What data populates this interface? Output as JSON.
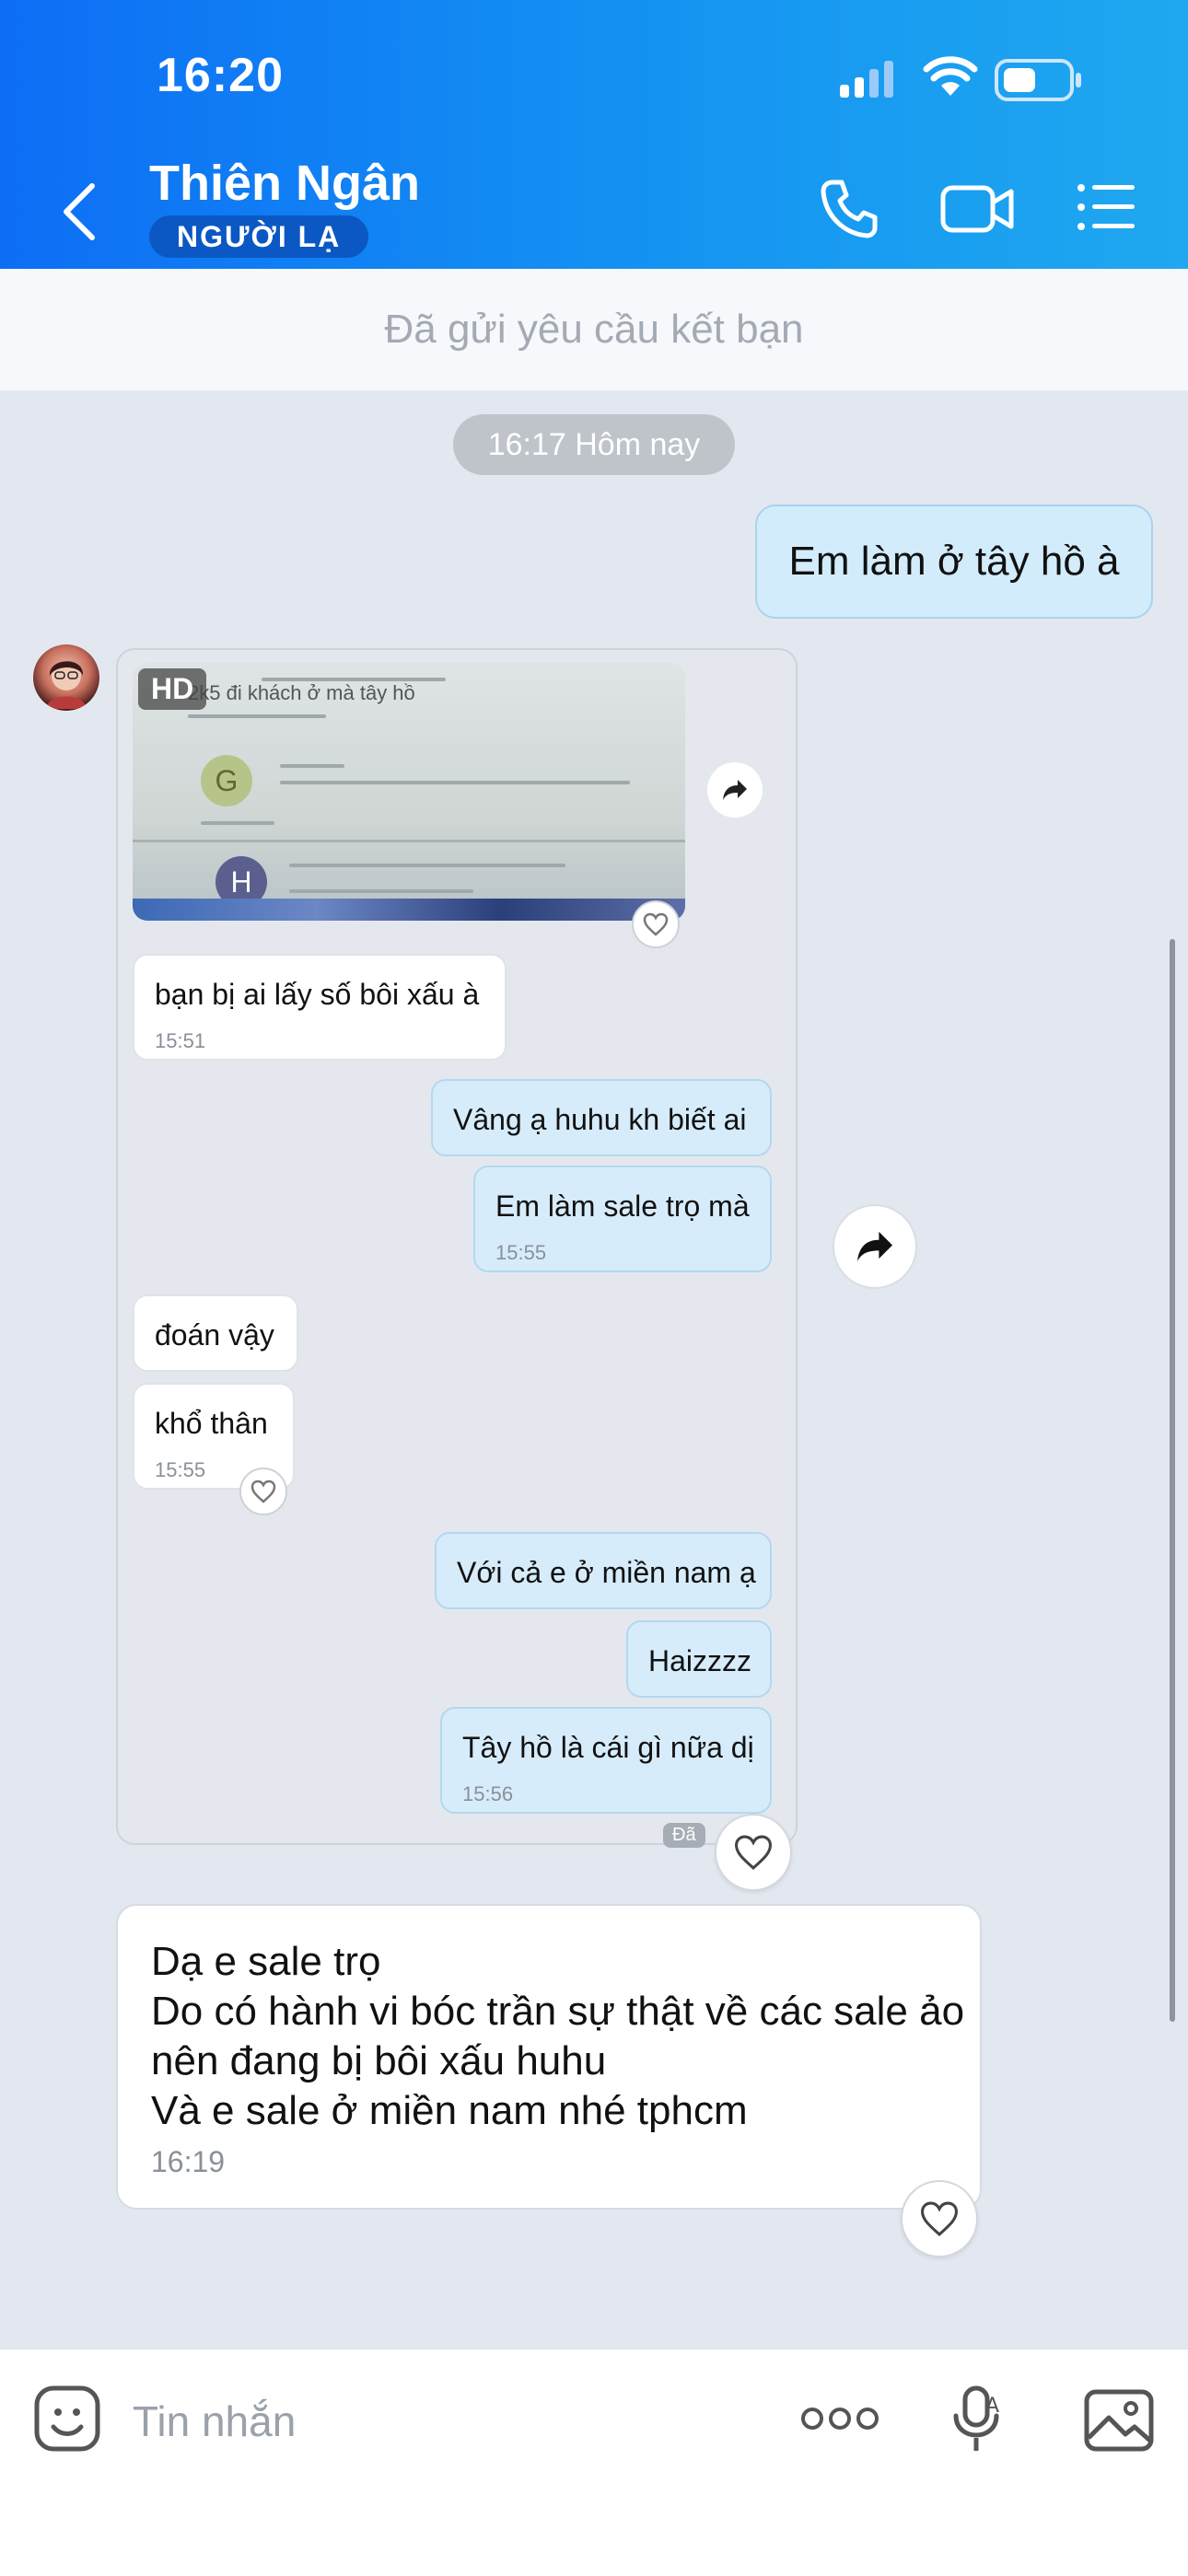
{
  "status_bar": {
    "time": "16:20"
  },
  "header": {
    "contact_name": "Thiên Ngân",
    "badge": "NGƯỜI LẠ"
  },
  "friend_request_text": "Đã gửi yêu cầu kết bạn",
  "time_divider": "16:17 Hôm nay",
  "messages": {
    "outgoing_1": "Em làm ở tây hồ à",
    "incoming_final": {
      "text": "Dạ e sale trọ\nDo có hành vi bóc trần sự thật về các sale ảo nên đang bị bôi xấu huhu\nVà e sale ở miền nam nhé tphcm",
      "time": "16:19"
    }
  },
  "screenshot": {
    "hd_label": "HD",
    "photo_text": {
      "line1": "2k5 đi khách ở mà tây hồ",
      "avatar_g": "G",
      "avatar_h": "H"
    },
    "chat": [
      {
        "dir": "in",
        "text": "bạn bị ai lấy số bôi xấu à",
        "time": "15:51"
      },
      {
        "dir": "out",
        "text": "Vâng ạ huhu kh biết ai",
        "time": ""
      },
      {
        "dir": "out",
        "text": "Em làm sale trọ mà",
        "time": "15:55"
      },
      {
        "dir": "in",
        "text": "đoán vậy",
        "time": ""
      },
      {
        "dir": "in",
        "text": "khổ thân",
        "time": "15:55"
      },
      {
        "dir": "out",
        "text": "Với cả e ở miền nam ạ",
        "time": ""
      },
      {
        "dir": "out",
        "text": "Haizzzz",
        "time": ""
      },
      {
        "dir": "out",
        "text": "Tây hồ là cái gì nữa dị",
        "time": "15:56"
      }
    ],
    "seen_label": "Đã"
  },
  "composer": {
    "placeholder": "Tin nhắn"
  },
  "colors": {
    "header_start": "#0d6ef5",
    "header_end": "#1fa8ef",
    "outgoing_bubble": "#d3ecfc",
    "chat_background": "#e3e8f0"
  }
}
